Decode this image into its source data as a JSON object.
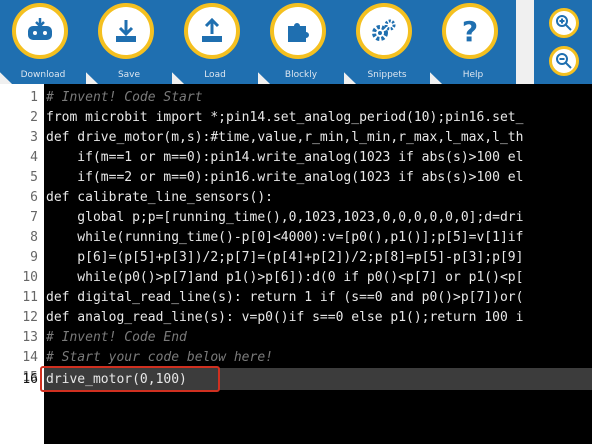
{
  "toolbar": {
    "download": "Download",
    "save": "Save",
    "load": "Load",
    "blockly": "Blockly",
    "snippets": "Snippets",
    "help": "Help"
  },
  "editor": {
    "line_numbers": [
      "1",
      "2",
      "3",
      "4",
      "5",
      "6",
      "7",
      "8",
      "9",
      "10",
      "11",
      "12",
      "13",
      "14",
      "15",
      "16"
    ],
    "active_line": "16",
    "lines": [
      "# Invent! Code Start",
      "from microbit import *;pin14.set_analog_period(10);pin16.set_",
      "def drive_motor(m,s):#time,value,r_min,l_min,r_max,l_max,l_th",
      "    if(m==1 or m==0):pin14.write_analog(1023 if abs(s)>100 el",
      "    if(m==2 or m==0):pin16.write_analog(1023 if abs(s)>100 el",
      "def calibrate_line_sensors():",
      "    global p;p=[running_time(),0,1023,1023,0,0,0,0,0,0];d=dri",
      "    while(running_time()-p[0]<4000):v=[p0(),p1()];p[5]=v[1]if",
      "    p[6]=(p[5]+p[3])/2;p[7]=(p[4]+p[2])/2;p[8]=p[5]-p[3];p[9]",
      "    while(p0()>p[7]and p1()>p[6]):d(0 if p0()<p[7] or p1()<p[",
      "def digital_read_line(s): return 1 if (s==0 and p0()>p[7])or(",
      "def analog_read_line(s): v=p0()if s==0 else p1();return 100 i",
      "# Invent! Code End",
      "# Start your code below here!",
      "",
      "drive_motor(0,100)"
    ]
  },
  "colors": {
    "toolbar_blue": "#1f6fb0",
    "accent_yellow": "#f4c020",
    "highlight_red": "#d03020",
    "editor_bg": "#000000"
  },
  "icons": [
    "microbit-icon",
    "download-icon",
    "upload-icon",
    "puzzle-icon",
    "gears-icon",
    "question-icon",
    "zoom-in-icon",
    "zoom-out-icon"
  ]
}
